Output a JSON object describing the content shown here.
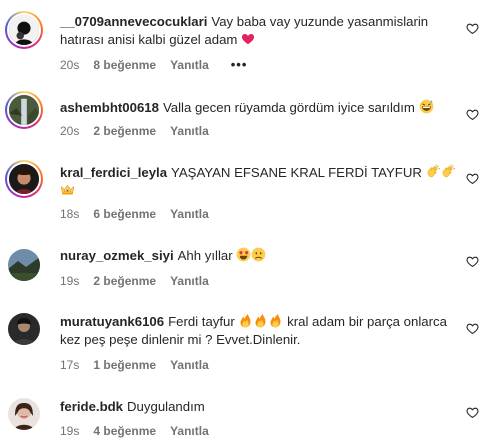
{
  "labels": {
    "likes_suffix": "beğenme",
    "reply": "Yanıtla",
    "more": "•••"
  },
  "comments": [
    {
      "username": "__0709annevecocuklari",
      "text": "Vay baba vay yuzunde yasanmislarin hatırası anisi kalbi güzel adam",
      "emojis": [
        "red-heart"
      ],
      "time": "20s",
      "likes": "8 beğenme",
      "reply": "Yanıtla",
      "more": "•••",
      "story_ring": true
    },
    {
      "username": "ashembht00618",
      "text": "Valla gecen rüyamda gördüm iyice sarıldım",
      "emojis": [
        "grinning-sweat"
      ],
      "time": "20s",
      "likes": "2 beğenme",
      "reply": "Yanıtla",
      "story_ring": true
    },
    {
      "username": "kral_ferdici_leyla",
      "text": "YAŞAYAN EFSANE KRAL FERDİ TAYFUR",
      "emojis": [
        "clapping-hands",
        "clapping-hands",
        "crown"
      ],
      "time": "18s",
      "likes": "6 beğenme",
      "reply": "Yanıtla",
      "story_ring": true
    },
    {
      "username": "nuray_ozmek_siyi",
      "text": "Ahh yıllar",
      "emojis": [
        "heart-eyes",
        "sad-face"
      ],
      "time": "19s",
      "likes": "2 beğenme",
      "reply": "Yanıtla",
      "story_ring": false
    },
    {
      "username": "muratuyank6106",
      "text_before": "Ferdi tayfur",
      "text_after": "kral adam bir parça onlarca kez peş peşe dinlenir mi ? Evvet.Dinlenir.",
      "emojis": [
        "fire",
        "fire",
        "fire"
      ],
      "time": "17s",
      "likes": "1 beğenme",
      "reply": "Yanıtla",
      "story_ring": false
    },
    {
      "username": "feride.bdk",
      "text": "Duygulandım",
      "emojis": [],
      "time": "19s",
      "likes": "4 beğenme",
      "reply": "Yanıtla",
      "story_ring": false
    }
  ],
  "colors": {
    "text": "#262626",
    "meta": "#737373",
    "heart_red": "#e0245e"
  }
}
